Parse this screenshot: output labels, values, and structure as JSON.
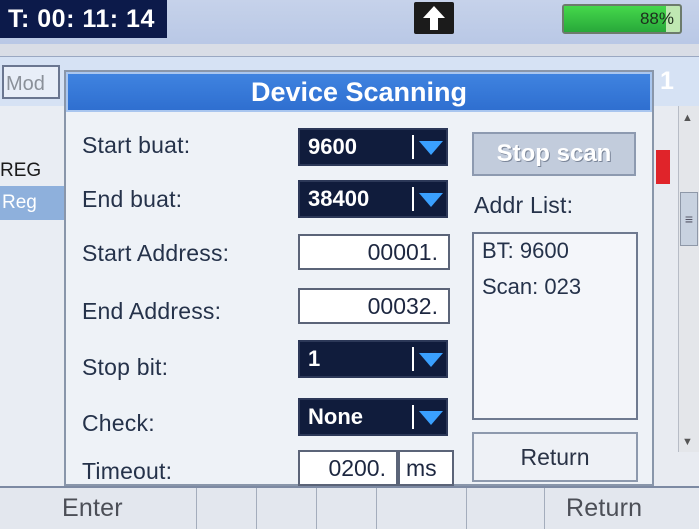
{
  "status": {
    "time": "T: 00: 11: 14",
    "battery_label": "88%",
    "battery_level": 0.88
  },
  "background": {
    "tab_label": "Mod",
    "tab_suffix": "1",
    "rows": [
      "REG",
      "Reg"
    ]
  },
  "dialog": {
    "title": "Device Scanning",
    "fields": [
      {
        "label": "Start buat:",
        "type": "select",
        "value": "9600"
      },
      {
        "label": "End buat:",
        "type": "select",
        "value": "38400"
      },
      {
        "label": "Start Address:",
        "type": "input",
        "value": "00001."
      },
      {
        "label": "End Address:",
        "type": "input",
        "value": "00032."
      },
      {
        "label": "Stop bit:",
        "type": "select",
        "value": "1"
      },
      {
        "label": "Check:",
        "type": "select",
        "value": "None"
      },
      {
        "label": "Timeout:",
        "type": "input",
        "value": "0200.",
        "unit": "ms"
      }
    ],
    "stop_button": "Stop scan",
    "addr_list_label": "Addr List:",
    "addr_list_lines": [
      "BT:  9600",
      "Scan: 023"
    ],
    "return_button": "Return"
  },
  "bottom_bar": {
    "enter": "Enter",
    "return": "Return"
  },
  "colors": {
    "title_bar": "#2f6fd0",
    "select_bg": "#101c3c",
    "dropdown_arrow": "#3aa0ff",
    "battery_fill": "#34c243"
  }
}
